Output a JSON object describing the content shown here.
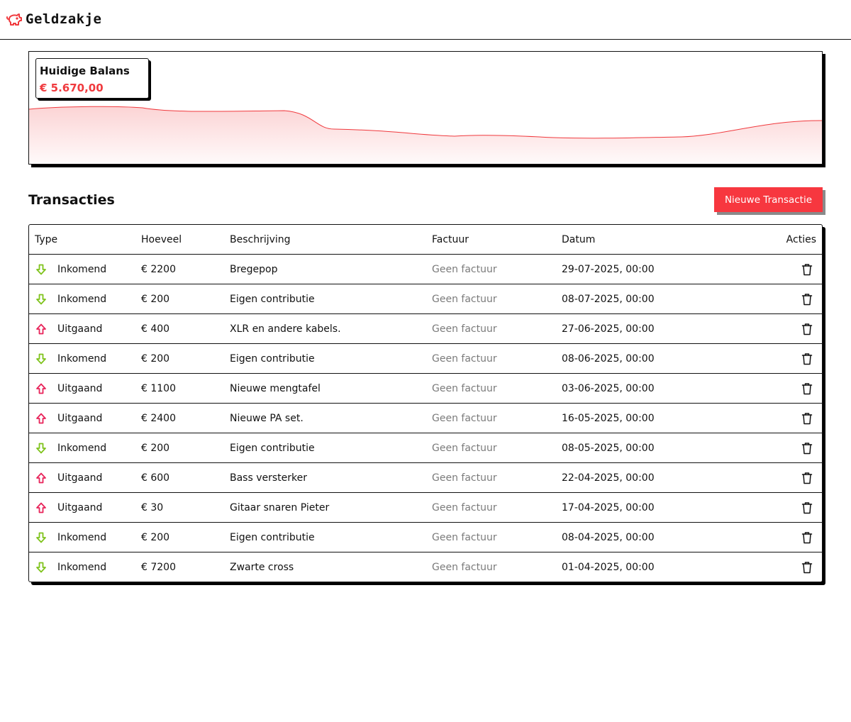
{
  "app": {
    "name": "Geldzakje",
    "logo_icon": "piggy-bank-icon",
    "brand_color": "#f03a3e"
  },
  "balance": {
    "title": "Huidige Balans",
    "amount": "€ 5.670,00",
    "chart_type": "area",
    "chart_color": "#f03a3e"
  },
  "transactions": {
    "title": "Transacties",
    "new_button_label": "Nieuwe Transactie",
    "columns": {
      "type": "Type",
      "amount": "Hoeveel",
      "description": "Beschrijving",
      "invoice": "Factuur",
      "date": "Datum",
      "actions": "Acties"
    },
    "icons": {
      "incoming": "arrow-down-icon",
      "outgoing": "arrow-up-icon",
      "delete": "trash-icon",
      "incoming_color": "#7fc31c",
      "outgoing_color": "#e8245a"
    },
    "rows": [
      {
        "direction": "in",
        "type": "Inkomend",
        "amount": "€ 2200",
        "description": "Bregepop",
        "invoice": "Geen factuur",
        "date": "29-07-2025, 00:00"
      },
      {
        "direction": "in",
        "type": "Inkomend",
        "amount": "€ 200",
        "description": "Eigen contributie",
        "invoice": "Geen factuur",
        "date": "08-07-2025, 00:00"
      },
      {
        "direction": "out",
        "type": "Uitgaand",
        "amount": "€ 400",
        "description": "XLR en andere kabels.",
        "invoice": "Geen factuur",
        "date": "27-06-2025, 00:00"
      },
      {
        "direction": "in",
        "type": "Inkomend",
        "amount": "€ 200",
        "description": "Eigen contributie",
        "invoice": "Geen factuur",
        "date": "08-06-2025, 00:00"
      },
      {
        "direction": "out",
        "type": "Uitgaand",
        "amount": "€ 1100",
        "description": "Nieuwe mengtafel",
        "invoice": "Geen factuur",
        "date": "03-06-2025, 00:00"
      },
      {
        "direction": "out",
        "type": "Uitgaand",
        "amount": "€ 2400",
        "description": "Nieuwe PA set.",
        "invoice": "Geen factuur",
        "date": "16-05-2025, 00:00"
      },
      {
        "direction": "in",
        "type": "Inkomend",
        "amount": "€ 200",
        "description": "Eigen contributie",
        "invoice": "Geen factuur",
        "date": "08-05-2025, 00:00"
      },
      {
        "direction": "out",
        "type": "Uitgaand",
        "amount": "€ 600",
        "description": "Bass versterker",
        "invoice": "Geen factuur",
        "date": "22-04-2025, 00:00"
      },
      {
        "direction": "out",
        "type": "Uitgaand",
        "amount": "€ 30",
        "description": "Gitaar snaren Pieter",
        "invoice": "Geen factuur",
        "date": "17-04-2025, 00:00"
      },
      {
        "direction": "in",
        "type": "Inkomend",
        "amount": "€ 200",
        "description": "Eigen contributie",
        "invoice": "Geen factuur",
        "date": "08-04-2025, 00:00"
      },
      {
        "direction": "in",
        "type": "Inkomend",
        "amount": "€ 7200",
        "description": "Zwarte cross",
        "invoice": "Geen factuur",
        "date": "01-04-2025, 00:00"
      }
    ]
  }
}
